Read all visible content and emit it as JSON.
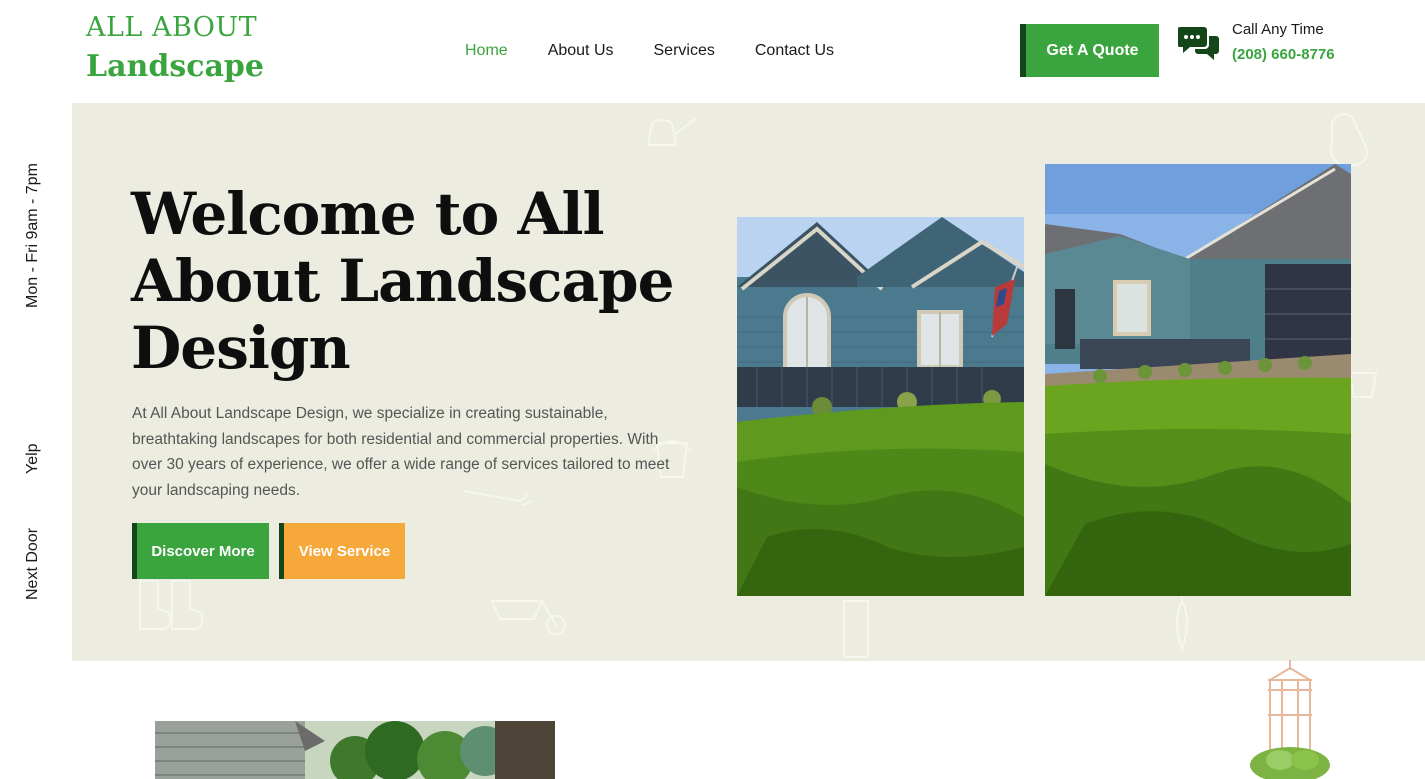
{
  "header": {
    "logo": {
      "line1": "ALL ABOUT",
      "line2": "Landscape"
    },
    "nav": [
      {
        "label": "Home",
        "active": true
      },
      {
        "label": "About Us",
        "active": false
      },
      {
        "label": "Services",
        "active": false
      },
      {
        "label": "Contact Us",
        "active": false
      }
    ],
    "quote_button": "Get A Quote",
    "contact": {
      "icon": "chat-bubbles-icon",
      "label": "Call Any Time",
      "phone": "(208) 660-8776"
    }
  },
  "side": {
    "hours": "Mon - Fri 9am - 7pm",
    "yelp": "Yelp",
    "nextdoor": "Next Door"
  },
  "hero": {
    "title": "Welcome to All About Landscape Design",
    "text": "At All About Landscape Design, we specialize in creating sustainable, breathtaking landscapes for both residential and commercial properties. With over 30 years of experience, we offer a wide range of services tailored to meet your landscaping needs.",
    "buttons": {
      "discover": "Discover More",
      "service": "View Service"
    }
  },
  "colors": {
    "brand_green": "#3aa53e",
    "dark_green": "#14461a",
    "orange": "#f7a83a",
    "hero_bg": "#ecede0"
  }
}
